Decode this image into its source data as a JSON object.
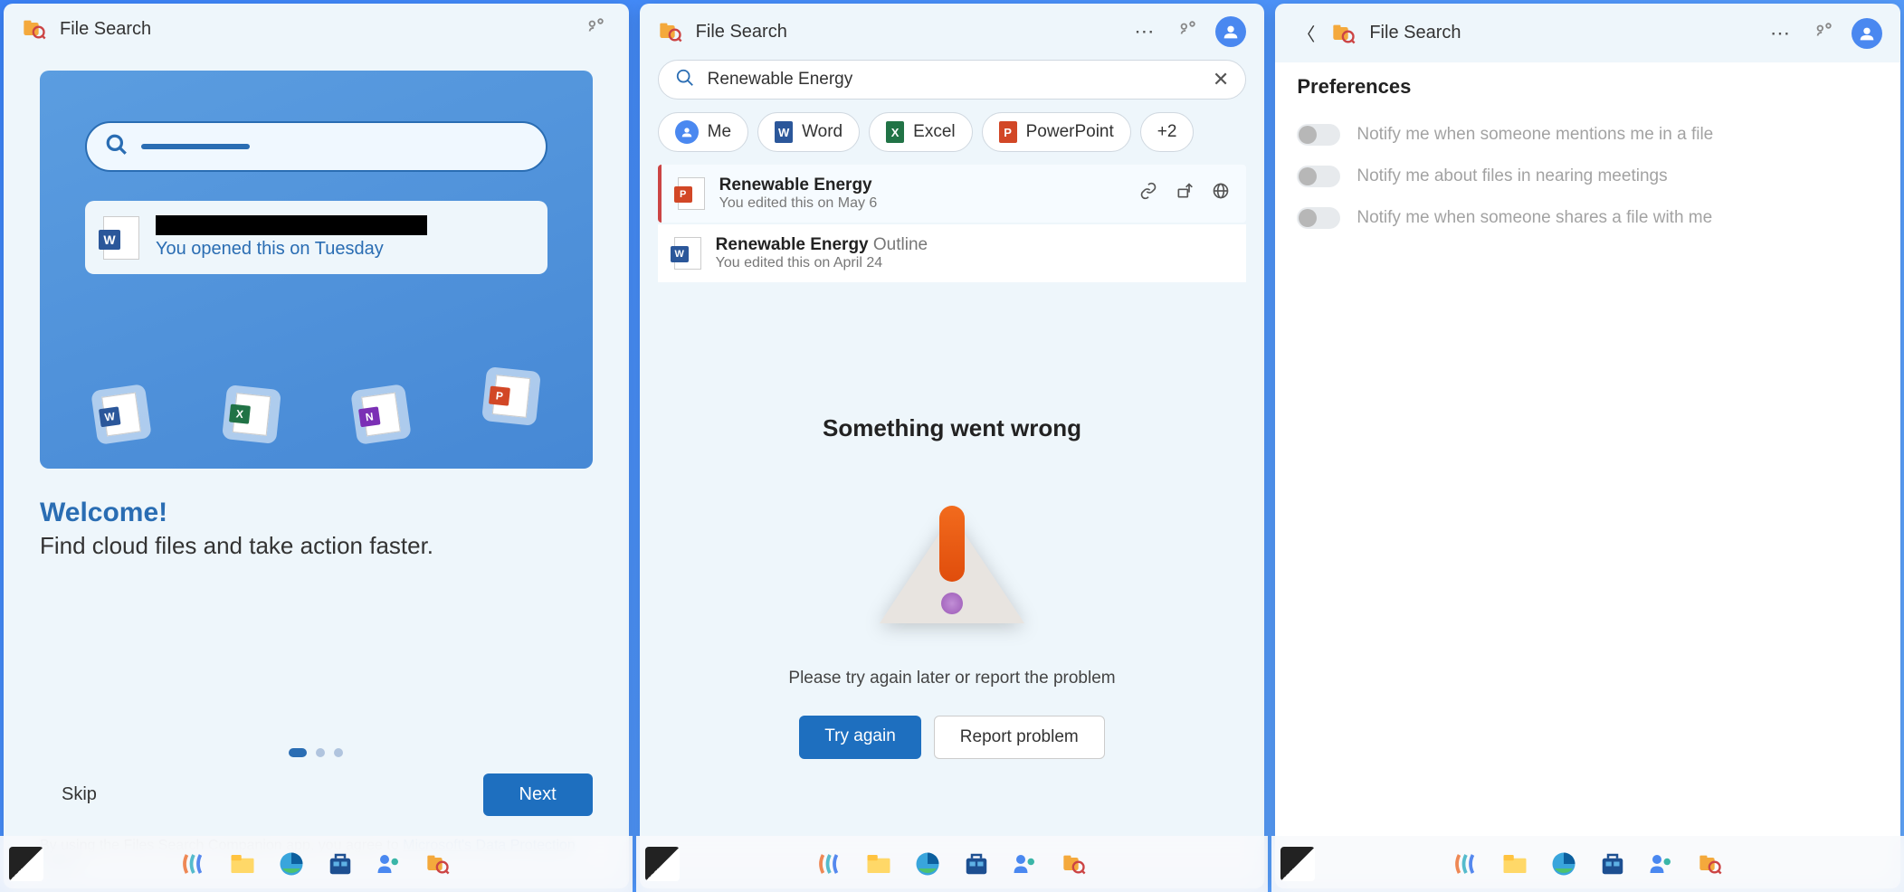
{
  "app_title": "File Search",
  "panel1": {
    "hero_sub": "You opened this on Tuesday",
    "welcome_title": "Welcome!",
    "welcome_sub": "Find cloud files and take action faster.",
    "skip": "Skip",
    "next": "Next",
    "disclaimer_prefix": "By using the Files Search Companion app, you agree to ",
    "disclaimer_link": "Microsoft's Data Protection Notice"
  },
  "panel2": {
    "search_value": "Renewable Energy",
    "filters": {
      "me": "Me",
      "word": "Word",
      "excel": "Excel",
      "powerpoint": "PowerPoint",
      "more": "+2"
    },
    "results": [
      {
        "title": "Renewable Energy",
        "suffix": "",
        "sub": "You edited this on May 6",
        "type": "ppt"
      },
      {
        "title": "Renewable Energy",
        "suffix": " Outline",
        "sub": "You edited this on April 24",
        "type": "word"
      }
    ],
    "error_title": "Something went wrong",
    "error_sub": "Please try again later or report the problem",
    "try_again": "Try again",
    "report": "Report problem"
  },
  "panel3": {
    "prefs_title": "Preferences",
    "opts": [
      "Notify me when someone mentions me in a file",
      "Notify me about files in nearing meetings",
      "Notify me when someone shares a file with me"
    ]
  }
}
